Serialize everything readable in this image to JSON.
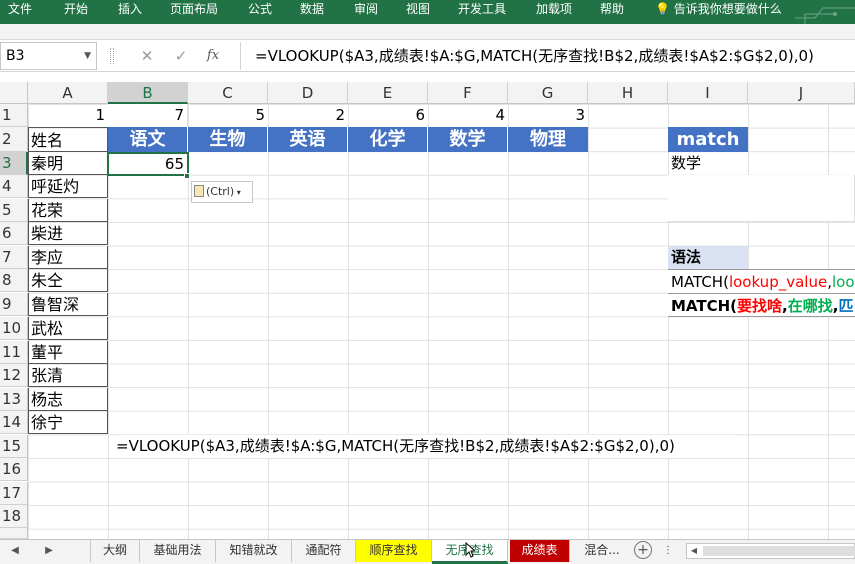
{
  "ribbon": {
    "tabs": [
      "文件",
      "开始",
      "插入",
      "页面布局",
      "公式",
      "数据",
      "审阅",
      "视图",
      "开发工具",
      "加载项",
      "帮助"
    ],
    "tell_me": "告诉我你想要做什么"
  },
  "formula_bar": {
    "name_box": "B3",
    "fx_label": "fx",
    "formula": "=VLOOKUP($A3,成绩表!$A:$G,MATCH(无序查找!B$2,成绩表!$A$2:$G$2,0),0)"
  },
  "columns": [
    "A",
    "B",
    "C",
    "D",
    "E",
    "F",
    "G",
    "H",
    "I",
    "J"
  ],
  "rows": [
    "1",
    "2",
    "3",
    "4",
    "5",
    "6",
    "7",
    "8",
    "9",
    "10",
    "11",
    "12",
    "13",
    "14",
    "15",
    "16",
    "17",
    "18"
  ],
  "row1_values": [
    "1",
    "7",
    "5",
    "2",
    "6",
    "4",
    "3"
  ],
  "row2_header": {
    "name_label": "姓名",
    "subjects": [
      "语文",
      "生物",
      "英语",
      "化学",
      "数学",
      "物理"
    ]
  },
  "names": [
    "秦明",
    "呼延灼",
    "花荣",
    "柴进",
    "李应",
    "朱仝",
    "鲁智深",
    "武松",
    "董平",
    "张清",
    "杨志",
    "徐宁"
  ],
  "b3_value": "65",
  "paste_options_label": "(Ctrl)",
  "side": {
    "match_header": "match",
    "match_value": "数学",
    "syntax_header": "语法",
    "syntax_line_prefix": "MATCH(",
    "syntax_arg1": "lookup_value",
    "syntax_sep": ",",
    "syntax_arg2_partial": "loo",
    "cn_prefix": "MATCH(",
    "cn_arg1": "要找啥",
    "cn_sep": ",",
    "cn_arg2": "在哪找",
    "cn_sep2": ",",
    "cn_arg3_partial": "匹"
  },
  "row15_formula_text": "=VLOOKUP($A3,成绩表!$A:$G,MATCH(无序查找!B$2,成绩表!$A$2:$G$2,0),0)",
  "sheet_tabs": [
    {
      "label": "大纲"
    },
    {
      "label": "基础用法"
    },
    {
      "label": "知错就改"
    },
    {
      "label": "通配符"
    },
    {
      "label": "顺序查找"
    },
    {
      "label": "无序查找"
    },
    {
      "label": "成绩表"
    },
    {
      "label": "混合..."
    }
  ],
  "colors": {
    "excel_green": "#217346",
    "header_blue": "#4472c4",
    "syntax_fill": "#d9e1f2",
    "tab_yellow": "#ffff00",
    "tab_red": "#c00000",
    "arg_red": "#ff0000",
    "arg_green": "#00b050",
    "arg_blue": "#0070c0"
  }
}
